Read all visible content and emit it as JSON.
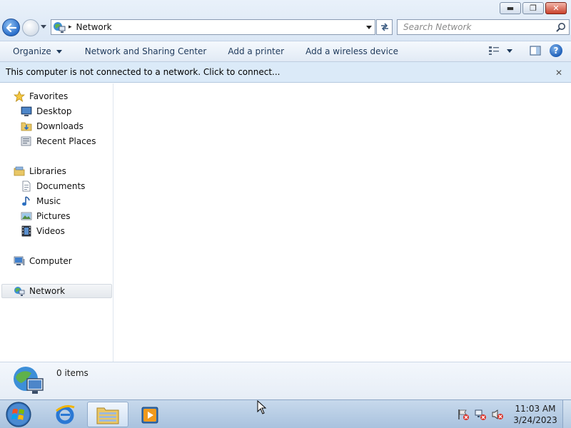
{
  "window": {
    "controls": {
      "minimize": "▬",
      "maximize": "❐",
      "close": "✕"
    }
  },
  "address": {
    "location": "Network",
    "separator": "▸"
  },
  "search": {
    "placeholder": "Search Network"
  },
  "toolbar": {
    "organize": "Organize",
    "network_sharing": "Network and Sharing Center",
    "add_printer": "Add a printer",
    "add_wireless": "Add a wireless device",
    "help": "?"
  },
  "infobar": {
    "message": "This computer is not connected to a network. Click to connect...",
    "close": "✕"
  },
  "sidebar": {
    "favorites": {
      "label": "Favorites",
      "items": [
        {
          "label": "Desktop",
          "icon": "desktop-icon"
        },
        {
          "label": "Downloads",
          "icon": "downloads-folder-icon"
        },
        {
          "label": "Recent Places",
          "icon": "recent-places-icon"
        }
      ]
    },
    "libraries": {
      "label": "Libraries",
      "items": [
        {
          "label": "Documents",
          "icon": "documents-icon"
        },
        {
          "label": "Music",
          "icon": "music-icon"
        },
        {
          "label": "Pictures",
          "icon": "pictures-icon"
        },
        {
          "label": "Videos",
          "icon": "videos-icon"
        }
      ]
    },
    "computer": {
      "label": "Computer"
    },
    "network": {
      "label": "Network",
      "selected": true
    }
  },
  "details": {
    "item_count": "0 items"
  },
  "taskbar": {
    "pinned": [
      "internet-explorer-icon",
      "windows-explorer-icon",
      "media-player-icon"
    ],
    "active": "windows-explorer-icon",
    "clock": {
      "time": "11:03 AM",
      "date": "3/24/2023"
    }
  },
  "colors": {
    "accent": "#1e395b",
    "infobar": "#dbeaf8",
    "taskbar": "#b8cde4"
  }
}
